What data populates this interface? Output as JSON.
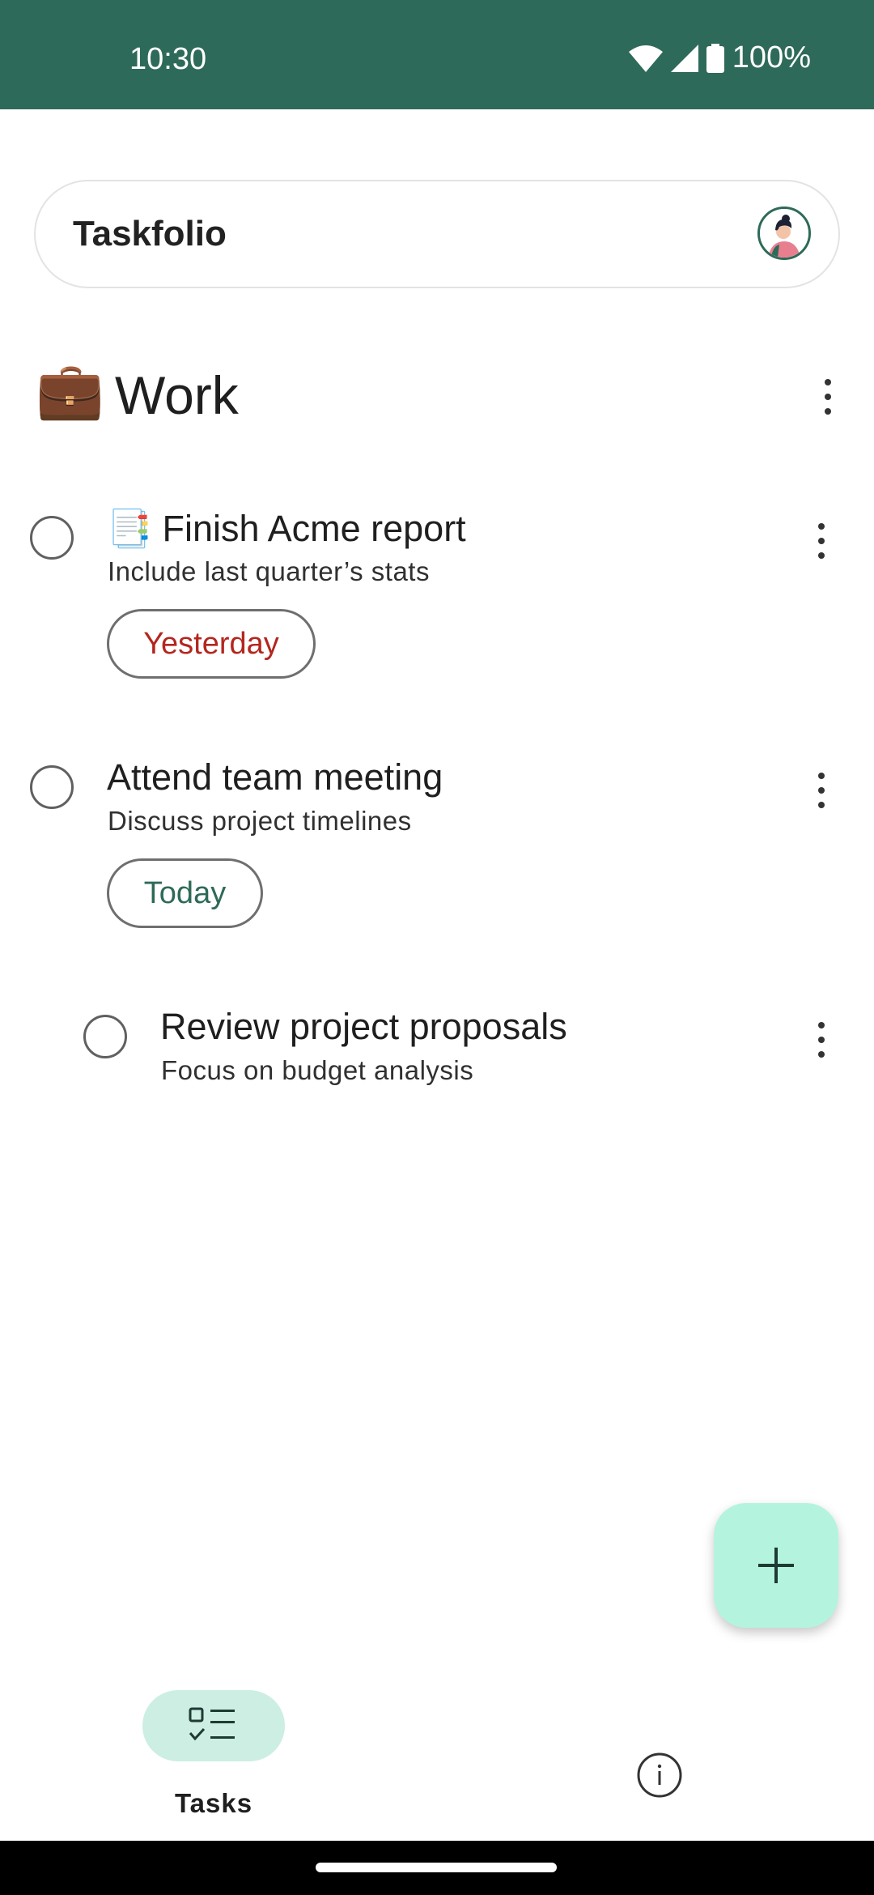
{
  "status_bar": {
    "time": "10:30",
    "battery": "100%"
  },
  "header": {
    "app_title": "Taskfolio"
  },
  "list": {
    "emoji": "💼",
    "title": "Work"
  },
  "tasks": [
    {
      "emoji": "📑",
      "title": "Finish Acme report",
      "description": "Include last quarter’s stats",
      "due": "Yesterday"
    },
    {
      "title": "Attend team meeting",
      "description": "Discuss project timelines",
      "due": "Today"
    },
    {
      "title": "Review project proposals",
      "description": "Focus on budget analysis"
    }
  ],
  "nav": {
    "tasks_label": "Tasks"
  },
  "colors": {
    "status_bar": "#2e6a59",
    "overdue": "#b3261e",
    "today": "#2e6a59",
    "fab": "#b4f4df",
    "nav_active": "#cceee3"
  },
  "icons": [
    "wifi-icon",
    "signal-icon",
    "battery-icon",
    "avatar",
    "more-vert-icon",
    "add-icon",
    "checklist-icon",
    "info-icon"
  ]
}
